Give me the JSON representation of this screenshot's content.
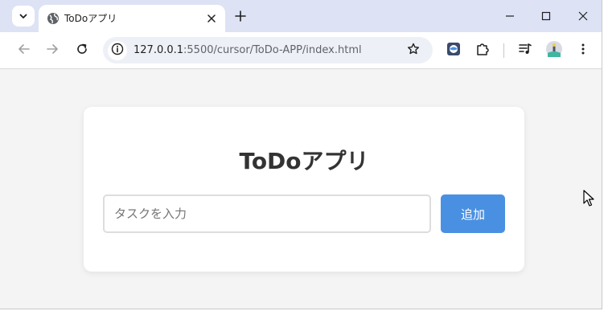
{
  "browser": {
    "tab": {
      "title": "ToDoアプリ",
      "favicon": "globe-icon"
    },
    "address": {
      "host": "127.0.0.1",
      "path": ":5500/cursor/ToDo-APP/index.html"
    },
    "colors": {
      "tabstrip": "#dde3f5",
      "accent": "#4a90e2"
    }
  },
  "app": {
    "title": "ToDoアプリ",
    "input": {
      "value": "",
      "placeholder": "タスクを入力"
    },
    "add_button": "追加"
  }
}
